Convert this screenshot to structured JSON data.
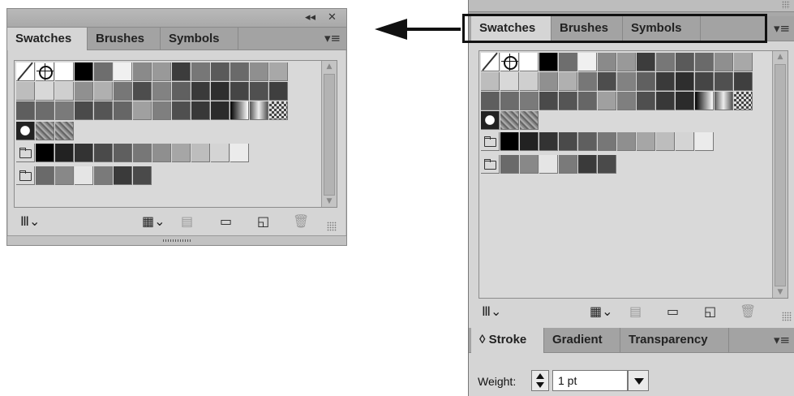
{
  "floating_panel": {
    "title_controls": {
      "collapse": "◂◂",
      "close": "✕"
    },
    "tabs": [
      "Swatches",
      "Brushes",
      "Symbols"
    ],
    "active_tab": "Swatches",
    "menu_icon": "▾≡"
  },
  "docked_panel": {
    "tabs": [
      "Swatches",
      "Brushes",
      "Symbols"
    ],
    "active_tab": "Swatches",
    "menu_icon": "▾≡"
  },
  "swatch_rows": {
    "row1": [
      "none",
      "registration",
      "#ffffff",
      "#000000",
      "#6e6e6e",
      "#f0f0f0",
      "#8a8a8a",
      "#999999",
      "#3c3c3c",
      "#777777",
      "#5a5a5a",
      "#6a6a6a",
      "#8f8f8f",
      "#a8a8a8"
    ],
    "row2": [
      "#bdbdbd",
      "#d8d8d8",
      "#cfcfcf",
      "#909090",
      "#b0b0b0",
      "#777777",
      "#4d4d4d",
      "#828282",
      "#606060",
      "#3a3a3a",
      "#2e2e2e",
      "#454545",
      "#505050",
      "#3f3f3f"
    ],
    "row3": [
      "#5e5e5e",
      "#6c6c6c",
      "#7a7a7a",
      "#4a4a4a",
      "#555555",
      "#666666",
      "#a0a0a0",
      "#7f7f7f",
      "#4f4f4f",
      "#383838",
      "#2b2b2b",
      "grad1",
      "grad2",
      "pattern"
    ],
    "row4": [
      "dots",
      "texture",
      "texture"
    ],
    "group1": [
      "folder",
      "#000000",
      "#222222",
      "#333333",
      "#4a4a4a",
      "#5f5f5f",
      "#777777",
      "#8f8f8f",
      "#a6a6a6",
      "#bdbdbd",
      "#d4d4d4",
      "#ebebeb"
    ],
    "group2": [
      "folder",
      "#6a6a6a",
      "#888888",
      "#e5e5e5",
      "#7a7a7a",
      "#3a3a3a",
      "#4a4a4a"
    ]
  },
  "toolbar_icons": [
    "swatch-libraries-icon",
    "show-kinds-icon",
    "swatch-options-icon",
    "new-color-group-icon",
    "new-swatch-icon",
    "delete-swatch-icon"
  ],
  "stroke_panel": {
    "tabs": [
      "◊ Stroke",
      "Gradient",
      "Transparency"
    ],
    "active_tab": "Stroke",
    "menu_icon": "▾≡",
    "weight_label": "Weight:",
    "weight_value": "1 pt"
  },
  "colors": {
    "panel_bg": "#d5d5d5",
    "tab_bar": "#a3a3a3",
    "highlight": "#111111"
  }
}
